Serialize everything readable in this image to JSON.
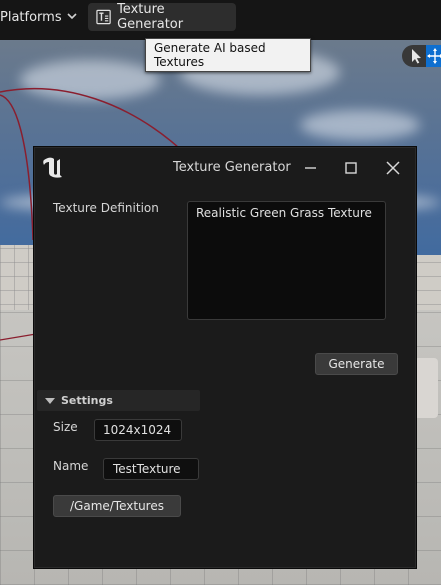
{
  "toolbar": {
    "platforms_label": "Platforms",
    "texture_generator_label": "Texture Generator"
  },
  "tooltip": {
    "text": "Generate AI based Textures"
  },
  "dialog": {
    "title": "Texture Generator",
    "definition_label": "Texture Definition",
    "definition_value": "Realistic Green Grass Texture",
    "generate_label": "Generate",
    "settings": {
      "header": "Settings",
      "size_label": "Size",
      "size_value": "1024x1024",
      "name_label": "Name",
      "name_value": "TestTexture",
      "path_label": "/Game/Textures"
    }
  },
  "icons": {
    "platforms_chevron": "chevron-down-icon",
    "texture_generator": "texture-icon",
    "logo": "unreal-logo-icon",
    "minimize": "minimize-icon",
    "maximize": "maximize-icon",
    "close": "close-icon",
    "select": "select-arrow-icon",
    "move": "move-icon",
    "settings_toggle": "triangle-down-icon"
  },
  "colors": {
    "accent": "#0e6fd0",
    "dialog_bg": "#1b1b1b",
    "toolbar_bg": "#151515"
  }
}
